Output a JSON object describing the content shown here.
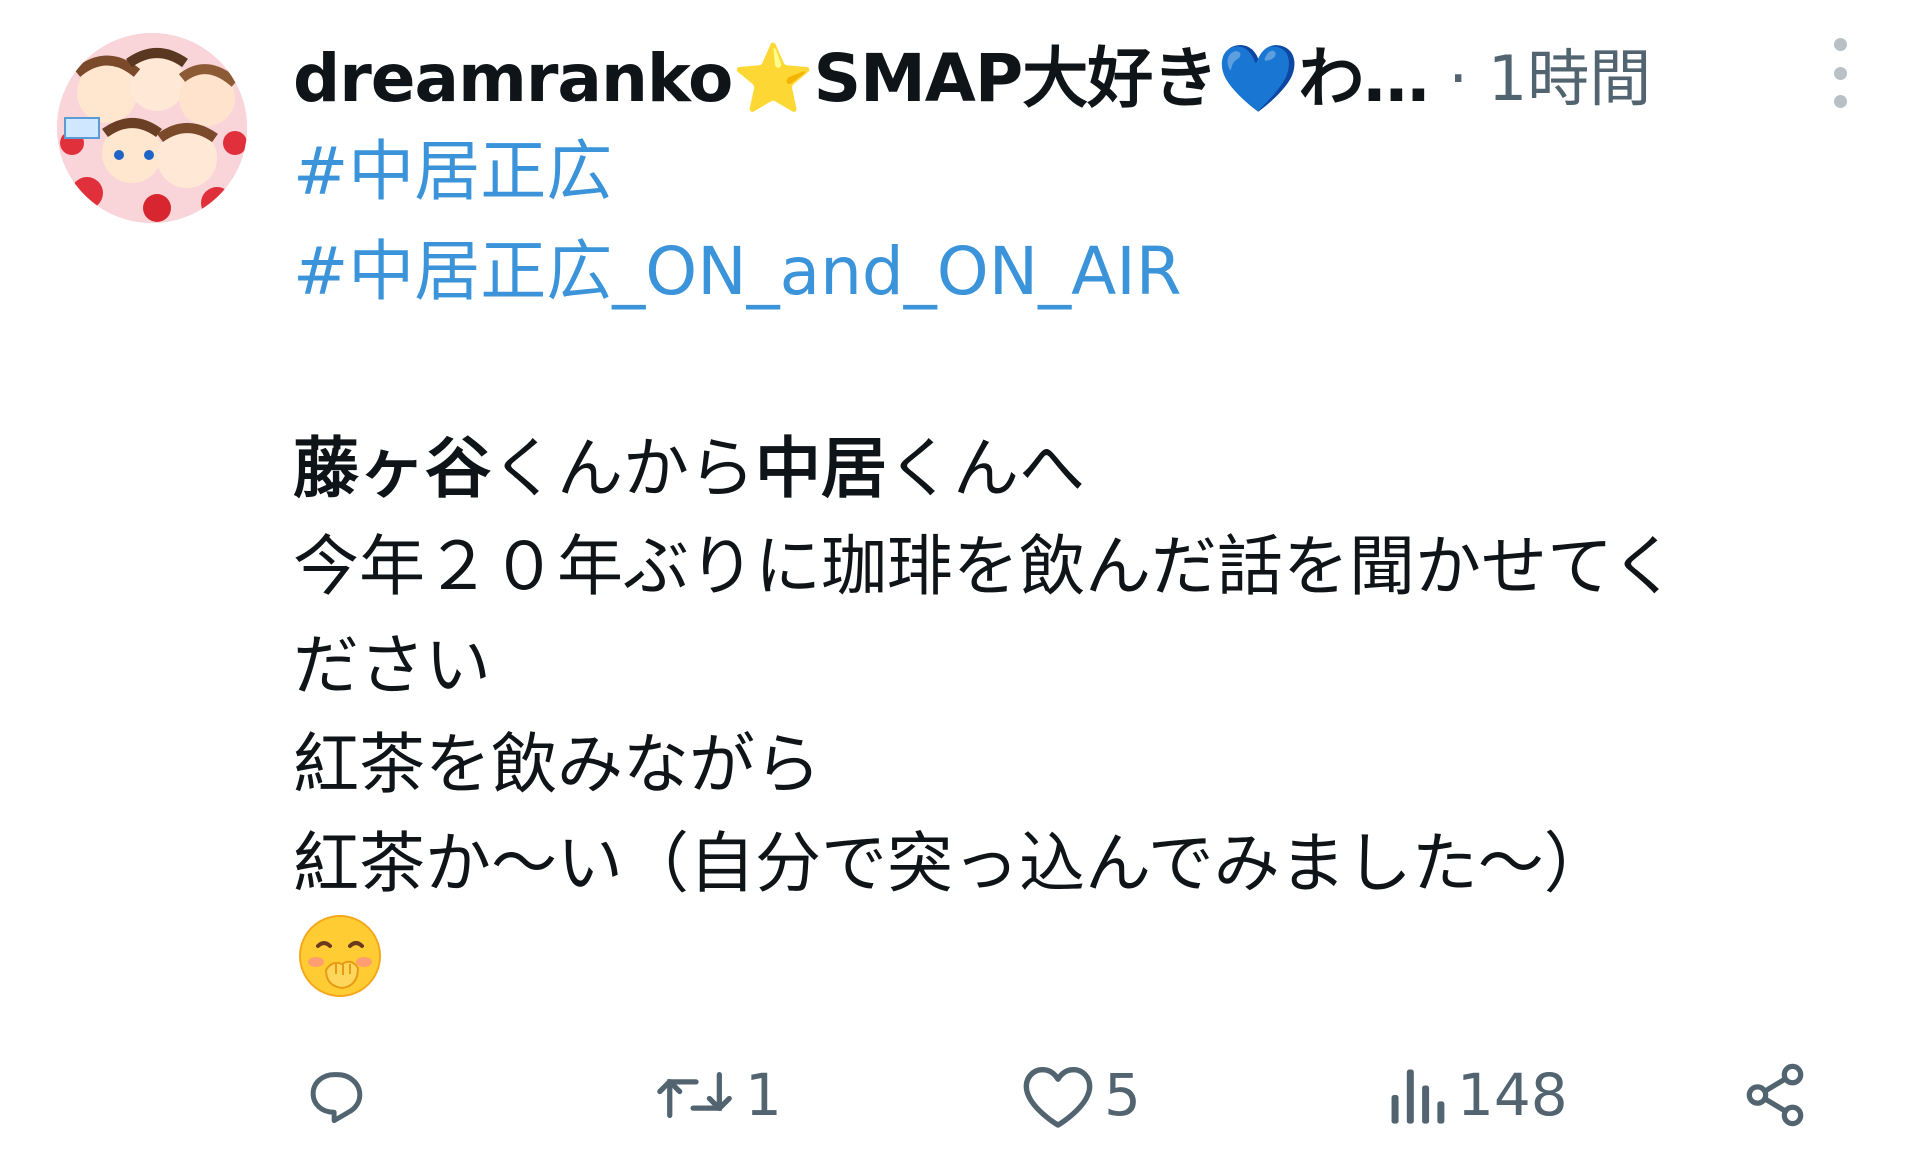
{
  "post": {
    "display_name": "dreamranko⭐SMAP大好き💙わ…",
    "meta": "· 1時間",
    "hashtags": [
      "#中居正広",
      "#中居正広_ON_and_ON_AIR"
    ],
    "lines": {
      "l1_bold1": "藤ヶ谷",
      "l1_text1": "くんから",
      "l1_bold2": "中居",
      "l1_text2": "くんへ",
      "l2": "今年２０年ぶりに珈琲を飲んだ話を聞かせてく",
      "l3": "ださい",
      "l4": "紅茶を飲みながら",
      "l5": "紅茶か～い（自分で突っ込んでみました～）"
    },
    "emoji": "hand-over-mouth-emoji"
  },
  "actions": {
    "reply": {
      "icon": "reply-icon",
      "count": ""
    },
    "retweet": {
      "icon": "retweet-icon",
      "count": "1"
    },
    "like": {
      "icon": "heart-icon",
      "count": "5"
    },
    "views": {
      "icon": "views-icon",
      "count": "148"
    },
    "share": {
      "icon": "share-icon"
    }
  },
  "colors": {
    "hashtag": "#3b94d9",
    "text": "#0f1419",
    "muted": "#536471"
  }
}
